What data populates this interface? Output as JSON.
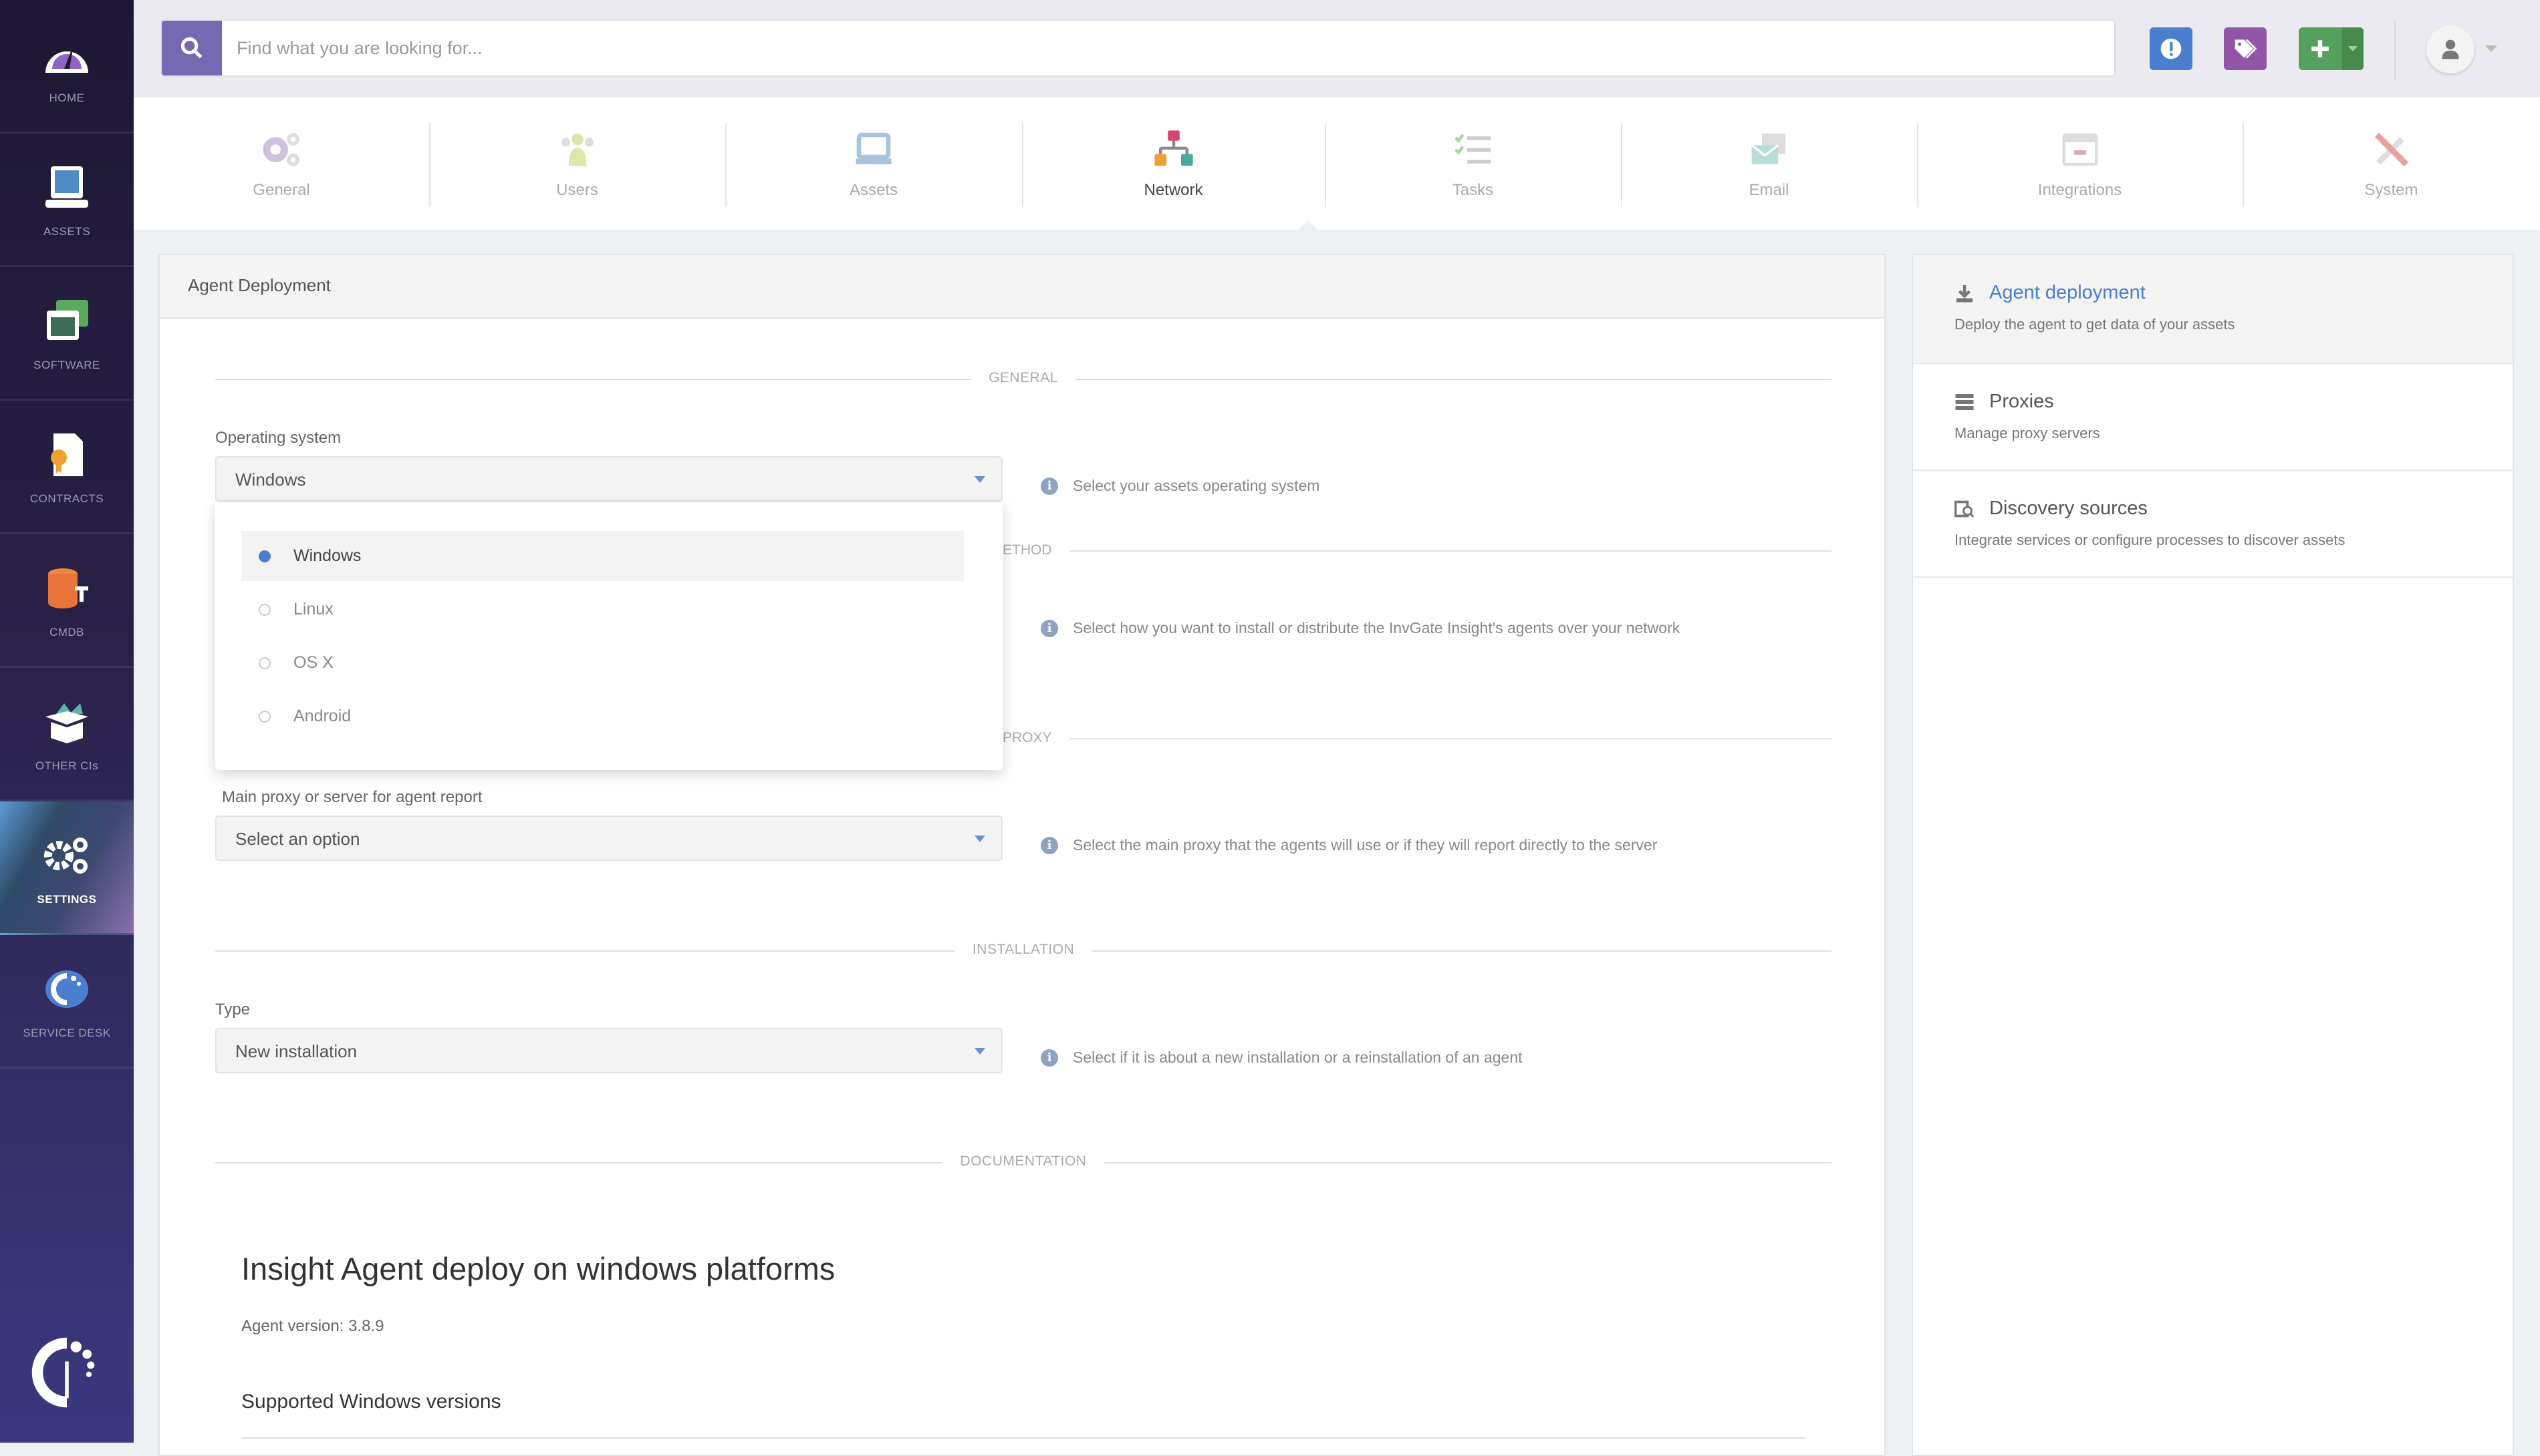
{
  "sidebar": {
    "items": [
      {
        "label": "HOME",
        "icon": "gauge-icon"
      },
      {
        "label": "ASSETS",
        "icon": "laptop-icon"
      },
      {
        "label": "SOFTWARE",
        "icon": "software-window-icon"
      },
      {
        "label": "CONTRACTS",
        "icon": "contract-icon"
      },
      {
        "label": "CMDB",
        "icon": "database-icon"
      },
      {
        "label": "OTHER CIs",
        "icon": "open-box-icon"
      },
      {
        "label": "SETTINGS",
        "icon": "gears-icon",
        "active": true
      },
      {
        "label": "SERVICE DESK",
        "icon": "service-desk-logo-icon"
      }
    ]
  },
  "search": {
    "placeholder": "Find what you are looking for..."
  },
  "colors": {
    "accent": "#7569b3",
    "alert": "#4a7fd0",
    "tag": "#9157a6",
    "add": "#55a05c",
    "link": "#4a7fd0"
  },
  "tabs": [
    {
      "label": "General"
    },
    {
      "label": "Users"
    },
    {
      "label": "Assets"
    },
    {
      "label": "Network",
      "active": true
    },
    {
      "label": "Tasks"
    },
    {
      "label": "Email"
    },
    {
      "label": "Integrations"
    },
    {
      "label": "System"
    }
  ],
  "main": {
    "title": "Agent Deployment",
    "sections": {
      "general": "GENERAL",
      "method_fragment": "ETHOD",
      "proxy_fragment": "PROXY",
      "installation": "INSTALLATION",
      "documentation": "DOCUMENTATION"
    },
    "os": {
      "label": "Operating system",
      "value": "Windows",
      "help": "Select your assets operating system",
      "options": [
        "Windows",
        "Linux",
        "OS X",
        "Android"
      ],
      "selected": "Windows"
    },
    "method": {
      "help": "Select how you want to install or distribute the InvGate Insight's agents over your network"
    },
    "proxy": {
      "label": "Main proxy or server for agent report",
      "value": "Select an option",
      "help": "Select the main proxy that the agents will use or if they will report directly to the server"
    },
    "type": {
      "label": "Type",
      "value": "New installation",
      "help": "Select if it is about a new installation or a reinstallation of an agent"
    },
    "doc": {
      "heading": "Insight Agent deploy on windows platforms",
      "version": "Agent version: 3.8.9",
      "subheading": "Supported Windows versions"
    }
  },
  "right": {
    "items": [
      {
        "title": "Agent deployment",
        "desc": "Deploy the agent to get data of your assets"
      },
      {
        "title": "Proxies",
        "desc": "Manage proxy servers"
      },
      {
        "title": "Discovery sources",
        "desc": "Integrate services or configure processes to discover assets"
      }
    ]
  }
}
